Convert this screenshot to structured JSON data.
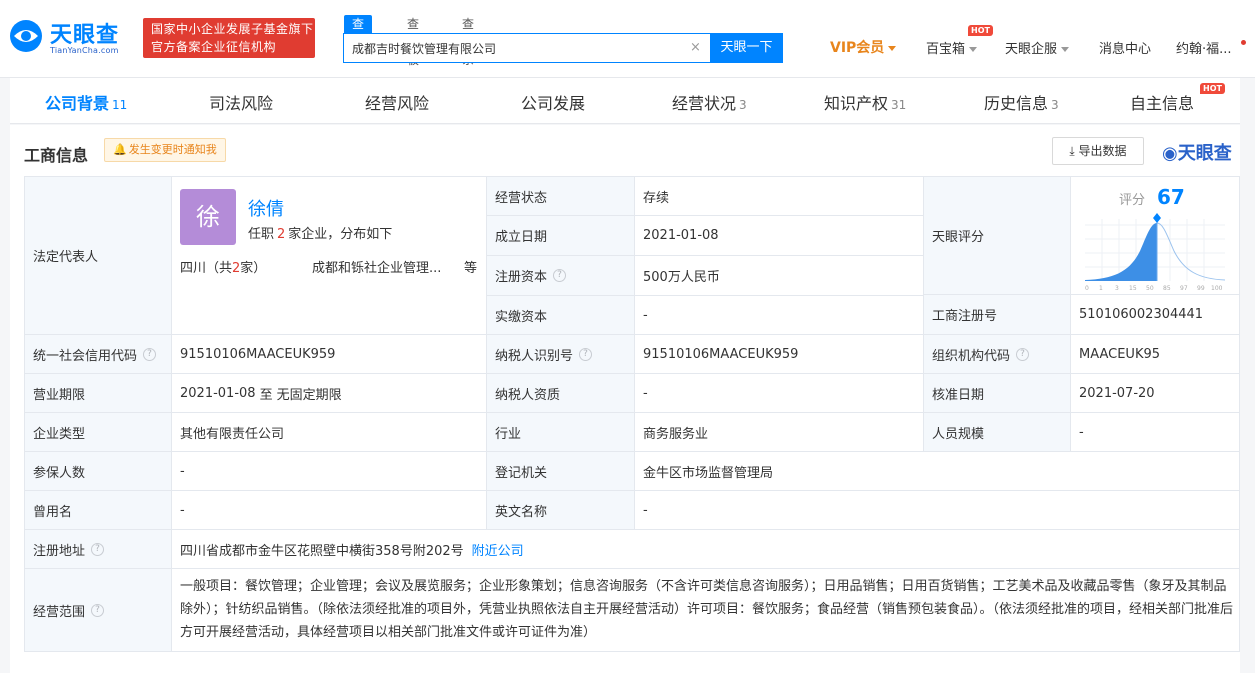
{
  "header": {
    "brand": "天眼查",
    "brand_domain": "TianYanCha.com",
    "gov_badge_line1": "国家中小企业发展子基金旗下",
    "gov_badge_line2": "官方备案企业征信机构",
    "search_tabs": [
      "查公司",
      "查老板",
      "查关系"
    ],
    "search_value": "成都吉时餐饮管理有限公司",
    "search_clear": "×",
    "search_button": "天眼一下",
    "nav": {
      "vip": "VIP会员",
      "treasure": "百宝箱",
      "treasure_badge": "HOT",
      "enterprise": "天眼企服",
      "messages": "消息中心",
      "user": "约翰·福..."
    }
  },
  "tabs": [
    {
      "label": "公司背景",
      "count": "11"
    },
    {
      "label": "司法风险",
      "count": ""
    },
    {
      "label": "经营风险",
      "count": ""
    },
    {
      "label": "公司发展",
      "count": ""
    },
    {
      "label": "经营状况",
      "count": "3"
    },
    {
      "label": "知识产权",
      "count": "31"
    },
    {
      "label": "历史信息",
      "count": "3"
    },
    {
      "label": "自主信息",
      "count": "",
      "badge": "HOT"
    }
  ],
  "panel": {
    "title": "工商信息",
    "notify": "发生变更时通知我",
    "export": "导出数据",
    "watermark": "天眼查"
  },
  "legal_rep": {
    "label": "法定代表人",
    "avatar_char": "徐",
    "name": "徐倩",
    "desc_prefix": "任职",
    "desc_count": "2",
    "desc_suffix": "家企业，分布如下",
    "region_prefix": "四川（共",
    "region_count": "2",
    "region_suffix": "家）",
    "company": "成都和铄社企业管理...",
    "more": "等"
  },
  "score": {
    "label": "评分",
    "value": "67",
    "axis_ticks": [
      "0",
      "1",
      "3",
      "15",
      "50",
      "85",
      "97",
      "99",
      "100"
    ],
    "cell_label": "天眼评分"
  },
  "fields": {
    "status_label": "经营状态",
    "status": "存续",
    "founded_label": "成立日期",
    "founded": "2021-01-08",
    "reg_capital_label": "注册资本",
    "reg_capital": "500万人民币",
    "paid_capital_label": "实缴资本",
    "paid_capital": "-",
    "reg_no_label": "工商注册号",
    "reg_no": "510106002304441",
    "credit_code_label": "统一社会信用代码",
    "credit_code": "91510106MAACEUK959",
    "taxpayer_id_label": "纳税人识别号",
    "taxpayer_id": "91510106MAACEUK959",
    "org_code_label": "组织机构代码",
    "org_code": "MAACEUK95",
    "term_label": "营业期限",
    "term_start": "2021-01-08",
    "term_to": "至",
    "term_end": "无固定期限",
    "tax_qual_label": "纳税人资质",
    "tax_qual": "-",
    "approve_date_label": "核准日期",
    "approve_date": "2021-07-20",
    "type_label": "企业类型",
    "type": "其他有限责任公司",
    "industry_label": "行业",
    "industry": "商务服务业",
    "staff_label": "人员规模",
    "staff": "-",
    "insured_label": "参保人数",
    "insured": "-",
    "authority_label": "登记机关",
    "authority": "金牛区市场监督管理局",
    "former_name_label": "曾用名",
    "former_name": "-",
    "english_name_label": "英文名称",
    "english_name": "-",
    "address_label": "注册地址",
    "address": "四川省成都市金牛区花照壁中横街358号附202号",
    "address_link": "附近公司",
    "scope_label": "经营范围",
    "scope": "一般项目：餐饮管理；企业管理；会议及展览服务；企业形象策划；信息咨询服务（不含许可类信息咨询服务）；日用品销售；日用百货销售；工艺美术品及收藏品零售（象牙及其制品除外）；针纺织品销售。（除依法须经批准的项目外，凭营业执照依法自主开展经营活动）许可项目：餐饮服务；食品经营（销售预包装食品）。（依法须经批准的项目，经相关部门批准后方可开展经营活动，具体经营项目以相关部门批准文件或许可证件为准）"
  },
  "colors": {
    "accent": "#0084ff",
    "vip": "#e8851c",
    "badge_red": "#e03c31",
    "label_bg": "#f4f8fc",
    "avatar_bg": "#b48cd8"
  }
}
